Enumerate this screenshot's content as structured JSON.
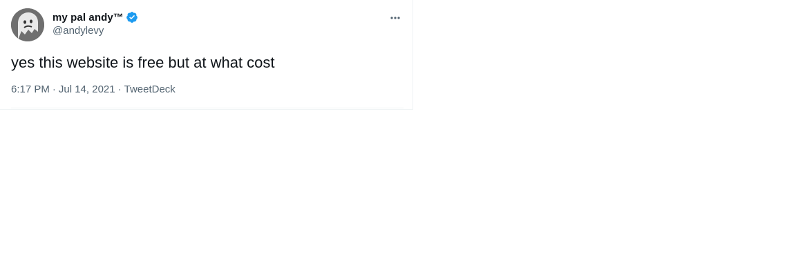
{
  "tweet": {
    "author": {
      "display_name": "my pal andy™",
      "handle": "@andylevy",
      "verified": true,
      "avatar_icon": "ghost-avatar",
      "verified_color": "#1d9bf0"
    },
    "more_icon": "ellipsis-icon",
    "text": "yes this website is free but at what cost",
    "meta": {
      "time": "6:17 PM",
      "separator": "·",
      "date": "Jul 14, 2021",
      "source": "TweetDeck"
    }
  }
}
